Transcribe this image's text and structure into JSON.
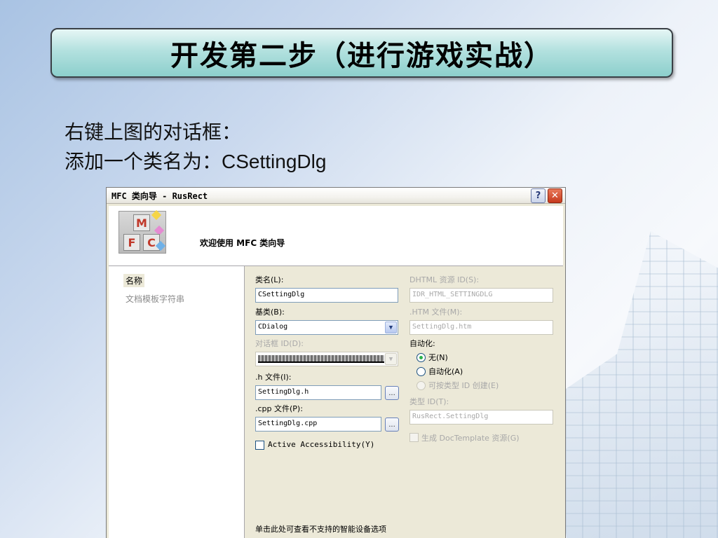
{
  "slide": {
    "title": "开发第二步（进行游戏实战）",
    "line1": "右键上图的对话框：",
    "line2_prefix": "添加一个类名为：",
    "line2_class": "CSettingDlg"
  },
  "dialog": {
    "title": "MFC 类向导 - RusRect",
    "help_glyph": "?",
    "close_glyph": "✕",
    "logo_letters": {
      "m": "M",
      "f": "F",
      "c": "C"
    },
    "header": "欢迎使用 MFC 类向导",
    "nav": [
      {
        "label": "名称",
        "active": true
      },
      {
        "label": "文档模板字符串",
        "active": false
      }
    ],
    "left": {
      "class_name_label": "类名(L):",
      "class_name_value": "CSettingDlg",
      "base_class_label": "基类(B):",
      "base_class_value": "CDialog",
      "dialog_id_label": "对话框 ID(D):",
      "h_file_label": ".h 文件(I):",
      "h_file_value": "SettingDlg.h",
      "cpp_file_label": ".cpp 文件(P):",
      "cpp_file_value": "SettingDlg.cpp",
      "dots": "...",
      "accessibility_label": "Active Accessibility(Y)",
      "footer_link": "单击此处可查看不支持的智能设备选项"
    },
    "right": {
      "dhtml_id_label": "DHTML 资源 ID(S):",
      "dhtml_id_value": "IDR_HTML_SETTINGDLG",
      "htm_file_label": ".HTM 文件(M):",
      "htm_file_value": "SettingDlg.htm",
      "automation_label": "自动化:",
      "radio_none": "无(N)",
      "radio_automation": "自动化(A)",
      "radio_creatable": "可按类型 ID 创建(E)",
      "type_id_label": "类型 ID(T):",
      "type_id_value": "RusRect.SettingDlg",
      "doctemplate_label": "生成 DocTemplate 资源(G)"
    }
  }
}
